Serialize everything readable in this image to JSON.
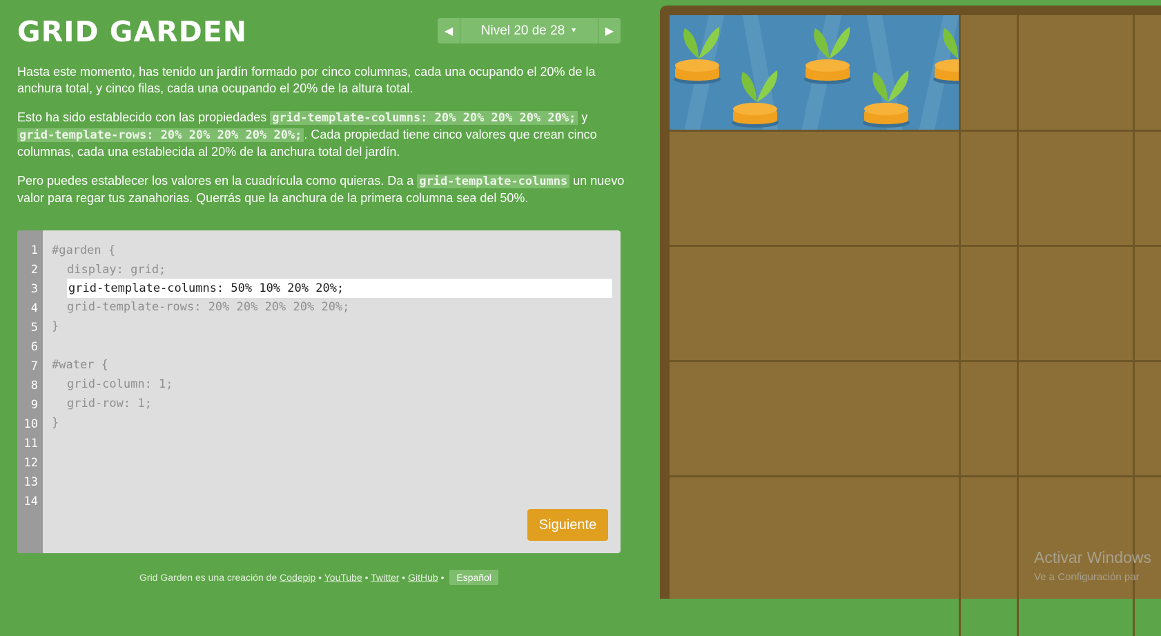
{
  "header": {
    "title": "GRID GARDEN",
    "level_text": "Nivel 20 de 28",
    "prev_icon": "chevron-left-icon",
    "next_icon": "chevron-right-icon"
  },
  "instructions": {
    "p1": "Hasta este momento, has tenido un jardín formado por cinco columnas, cada una ocupando el 20% de la anchura total, y cinco filas, cada una ocupando el 20% de la altura total.",
    "p2_a": "Esto ha sido establecido con las propiedades ",
    "p2_code1": "grid-template-columns: 20% 20% 20% 20% 20%;",
    "p2_b": " y ",
    "p2_code2": "grid-template-rows: 20% 20% 20% 20% 20%;",
    "p2_c": ". Cada propiedad tiene cinco valores que crean cinco columnas, cada una establecida al 20% de la anchura total del jardín.",
    "p3_a": "Pero puedes establecer los valores en la cuadrícula como quieras. Da a ",
    "p3_code": "grid-template-columns",
    "p3_b": " un nuevo valor para regar tus zanahorias. Querrás que la anchura de la primera columna sea del 50%."
  },
  "editor": {
    "line_numbers": [
      "1",
      "2",
      "3",
      "4",
      "5",
      "6",
      "7",
      "8",
      "9",
      "10",
      "11",
      "12",
      "13",
      "14"
    ],
    "l1": "#garden {",
    "l2": "display: grid;",
    "input_value": "grid-template-columns: 50% 10% 20% 20%;",
    "l4": "grid-template-rows: 20% 20% 20% 20% 20%;",
    "l5": "}",
    "l7": "#water {",
    "l8": "grid-column: 1;",
    "l9": "grid-row: 1;",
    "l10": "}",
    "next_button": "Siguiente"
  },
  "footer": {
    "text": "Grid Garden es una creación de ",
    "links": [
      "Codepip",
      "YouTube",
      "Twitter",
      "GitHub"
    ],
    "sep": " • ",
    "language": "Español"
  },
  "watermark": {
    "line1": "Activar Windows",
    "line2": "Ve a Configuración par"
  },
  "colors": {
    "background": "#5ca548",
    "accent_button": "#e19f1f",
    "water": "#4a8ab6",
    "soil": "#8b6f36"
  }
}
